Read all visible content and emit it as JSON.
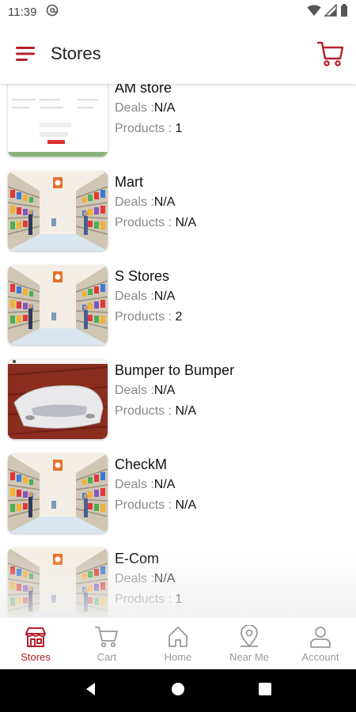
{
  "status_bar": {
    "time": "11:39"
  },
  "app_bar": {
    "title": "Stores"
  },
  "stores": [
    {
      "name": "AM store",
      "deals_label": "Deals :",
      "deals": "N/A",
      "products_label": "Products :",
      "products": "1",
      "image": "screenshot"
    },
    {
      "name": "Mart",
      "deals_label": "Deals :",
      "deals": "N/A",
      "products_label": "Products :",
      "products": "N/A",
      "image": "supermarket"
    },
    {
      "name": "S Stores",
      "deals_label": "Deals :",
      "deals": "N/A",
      "products_label": "Products :",
      "products": "2",
      "image": "supermarket"
    },
    {
      "name": "Bumper to Bumper",
      "deals_label": "Deals :",
      "deals": "N/A",
      "products_label": "Products :",
      "products": "N/A",
      "image": "car-bumper"
    },
    {
      "name": "CheckM",
      "deals_label": "Deals :",
      "deals": "N/A",
      "products_label": "Products :",
      "products": "N/A",
      "image": "supermarket"
    },
    {
      "name": "E-Com",
      "deals_label": "Deals :",
      "deals": "N/A",
      "products_label": "Products :",
      "products": "1",
      "image": "supermarket"
    }
  ],
  "bottom_nav": [
    {
      "label": "Stores",
      "icon": "store-icon",
      "active": true
    },
    {
      "label": "Cart",
      "icon": "cart-icon",
      "active": false
    },
    {
      "label": "Home",
      "icon": "home-icon",
      "active": false
    },
    {
      "label": "Near Me",
      "icon": "location-pin-icon",
      "active": false
    },
    {
      "label": "Account",
      "icon": "account-icon",
      "active": false
    }
  ],
  "colors": {
    "accent": "#b5202a",
    "inactive": "#999999"
  }
}
